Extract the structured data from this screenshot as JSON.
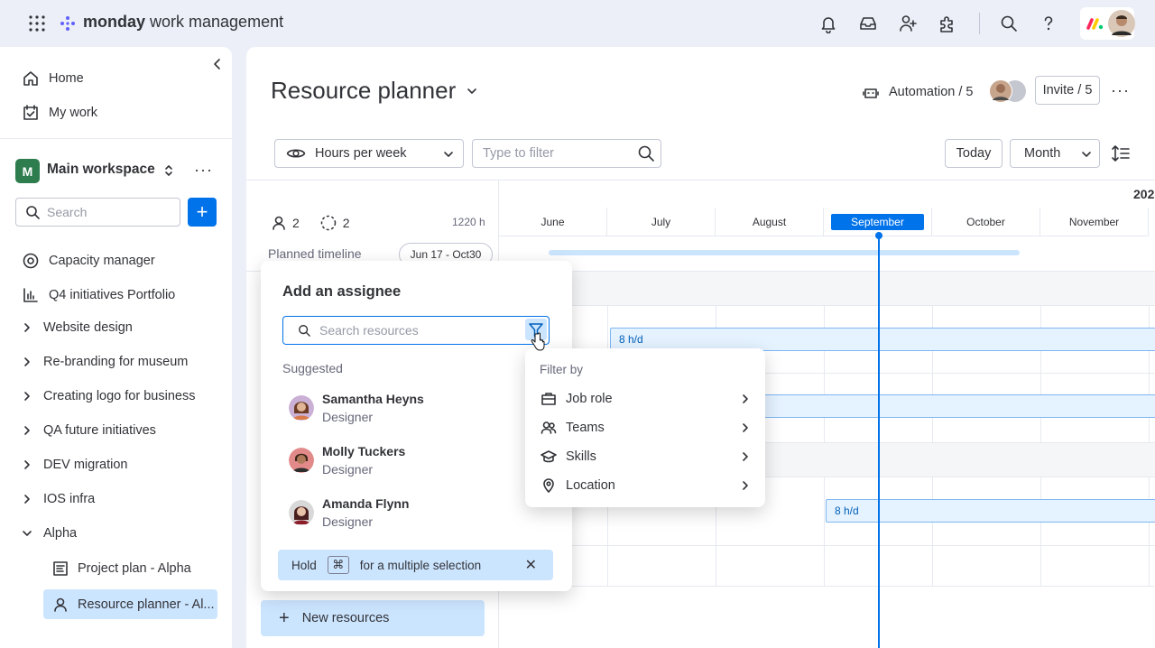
{
  "topbar": {
    "brand_bold": "monday",
    "brand_rest": " work management"
  },
  "sidebar": {
    "home": "Home",
    "my_work": "My work",
    "workspace_initial": "M",
    "workspace_name": "Main workspace",
    "search_placeholder": "Search",
    "items": [
      {
        "label": "Capacity manager",
        "icon": "capacity-icon"
      },
      {
        "label": "Q4 initiatives Portfolio",
        "icon": "portfolio-icon"
      },
      {
        "label": "Website design",
        "icon": "chevron-right-icon"
      },
      {
        "label": "Re-branding for museum",
        "icon": "chevron-right-icon"
      },
      {
        "label": "Creating logo for business",
        "icon": "chevron-right-icon"
      },
      {
        "label": "QA future initiatives",
        "icon": "chevron-right-icon"
      },
      {
        "label": "DEV migration",
        "icon": "chevron-right-icon"
      },
      {
        "label": "IOS infra",
        "icon": "chevron-right-icon"
      },
      {
        "label": "Alpha",
        "icon": "chevron-down-icon"
      }
    ],
    "sub_items": [
      {
        "label": "Project plan - Alpha",
        "icon": "board-icon"
      },
      {
        "label": "Resource planner - Al...",
        "icon": "person-icon",
        "active": true
      }
    ]
  },
  "main": {
    "title": "Resource planner",
    "automation": "Automation / 5",
    "invite": "Invite / 5",
    "hours_dropdown": "Hours per week",
    "filter_placeholder": "Type to filter",
    "today": "Today",
    "month": "Month",
    "year": "202",
    "months": [
      "June",
      "July",
      "August",
      "September",
      "October",
      "November"
    ],
    "active_month": "September",
    "people_count": "2",
    "pending_count": "2",
    "total_hours": "1220 h",
    "planned_label": "Planned timeline",
    "planned_range": "Jun 17 - Oct30",
    "alloc_1": "8 h/d",
    "alloc_2": "8 h/d",
    "new_resources": "New resources"
  },
  "assignee_popup": {
    "title": "Add an assignee",
    "search_placeholder": "Search resources",
    "suggested_label": "Suggested",
    "people": [
      {
        "name": "Samantha Heyns",
        "role": "Designer"
      },
      {
        "name": "Molly Tuckers",
        "role": "Designer"
      },
      {
        "name": "Amanda Flynn",
        "role": "Designer"
      }
    ],
    "hint_hold": "Hold",
    "hint_key": "⌘",
    "hint_rest": "for a multiple selection"
  },
  "filter_popup": {
    "title": "Filter by",
    "items": [
      {
        "label": "Job role",
        "icon": "briefcase-icon"
      },
      {
        "label": "Teams",
        "icon": "teams-icon"
      },
      {
        "label": "Skills",
        "icon": "graduation-cap-icon"
      },
      {
        "label": "Location",
        "icon": "location-pin-icon"
      }
    ]
  },
  "colors": {
    "primary": "#0073ea",
    "selected_bg": "#cce5ff",
    "workspace_badge": "#2e7d4f",
    "app_bg": "#eceff8"
  }
}
